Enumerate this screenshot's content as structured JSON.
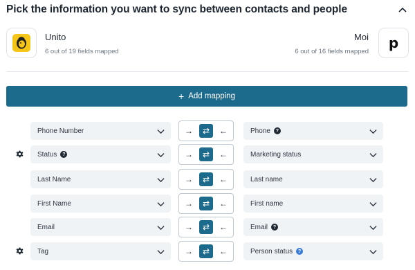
{
  "header": {
    "title": "Pick the information you want to sync between contacts and people"
  },
  "apps": {
    "left": {
      "name": "Unito",
      "fields_mapped": "6 out of 19 fields mapped"
    },
    "right": {
      "name": "Moi",
      "fields_mapped": "6 out of 16 fields mapped",
      "logo_letter": "p"
    }
  },
  "add_mapping": {
    "label": "Add mapping",
    "icon": "plus-icon"
  },
  "direction_glyphs": {
    "left_to_right": "→",
    "both": "⇄",
    "right_to_left": "←"
  },
  "mappings": [
    {
      "left": "Phone Number",
      "left_help": "",
      "right": "Phone",
      "right_help": "?",
      "has_settings": false,
      "direction": "both"
    },
    {
      "left": "Status",
      "left_help": "?",
      "right": "Marketing status",
      "right_help": "",
      "has_settings": true,
      "direction": "both"
    },
    {
      "left": "Last Name",
      "left_help": "",
      "right": "Last name",
      "right_help": "",
      "has_settings": false,
      "direction": "both"
    },
    {
      "left": "First Name",
      "left_help": "",
      "right": "First name",
      "right_help": "",
      "has_settings": false,
      "direction": "both"
    },
    {
      "left": "Email",
      "left_help": "",
      "right": "Email",
      "right_help": "?",
      "has_settings": false,
      "direction": "both"
    },
    {
      "left": "Tag",
      "left_help": "",
      "right": "Person status",
      "right_help": "?",
      "right_help_style": "blue",
      "has_settings": true,
      "direction": "both"
    }
  ],
  "colors": {
    "accent": "#1d6b8c",
    "field_bg": "#f0f3f6",
    "logo_yellow": "#f5c518"
  }
}
